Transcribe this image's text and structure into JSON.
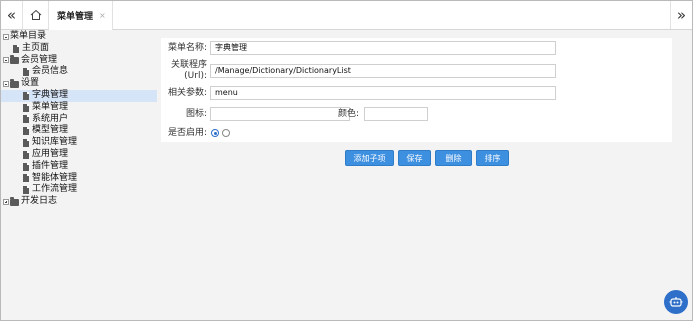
{
  "topbar": {
    "nav_left_glyph": "«",
    "nav_right_glyph": "»",
    "active_tab_label": "菜单管理",
    "tab_close_glyph": "×"
  },
  "tree": {
    "root": "菜单目录",
    "items": [
      {
        "label": "主页面"
      },
      {
        "label": "会员管理"
      },
      {
        "label": "会员信息"
      },
      {
        "label": "设置"
      },
      {
        "label": "字典管理"
      },
      {
        "label": "菜单管理"
      },
      {
        "label": "系统用户"
      },
      {
        "label": "模型管理"
      },
      {
        "label": "知识库管理"
      },
      {
        "label": "应用管理"
      },
      {
        "label": "插件管理"
      },
      {
        "label": "智能体管理"
      },
      {
        "label": "工作流管理"
      },
      {
        "label": "开发日志"
      }
    ]
  },
  "form": {
    "name_label": "菜单名称:",
    "name_value": "字典管理",
    "url_label_1": "关联程序",
    "url_label_2": "(Url):",
    "url_value": "/Manage/Dictionary/DictionaryList",
    "param_label": "相关参数:",
    "param_value": "menu",
    "icon_label": "图标:",
    "icon_value": "",
    "color_label": "颜色:",
    "color_value": "",
    "enabled_label": "是否启用:"
  },
  "actions": {
    "add_child": "添加子项",
    "save": "保存",
    "delete": "删除",
    "sort": "排序"
  },
  "colors": {
    "accent": "#3d8fe0",
    "selected_row": "#d6e4f7"
  }
}
